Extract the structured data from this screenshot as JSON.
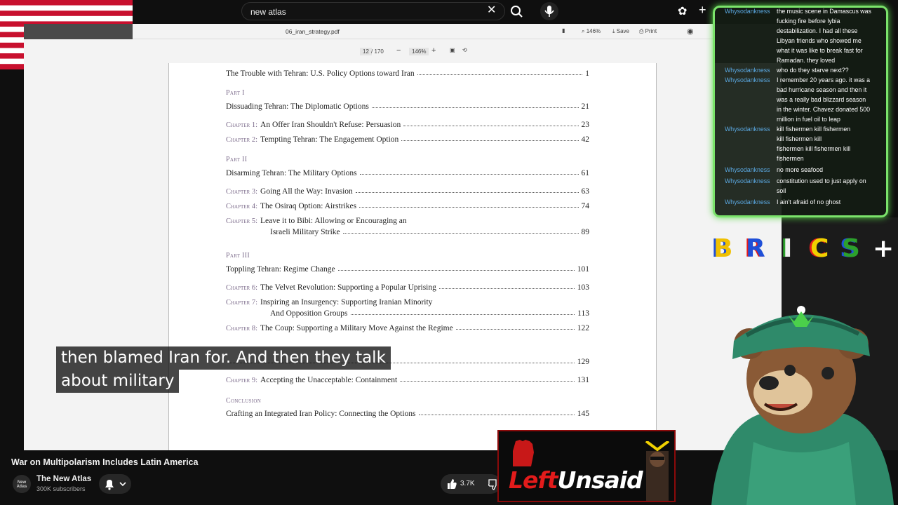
{
  "search": {
    "value": "new atlas"
  },
  "pdf": {
    "filename": "06_iran_strategy.pdf",
    "page_current": "12",
    "page_total": "/ 170",
    "zoom": "146%",
    "zoom_right": "146%",
    "save_label": "Save",
    "print_label": "Print"
  },
  "toc": {
    "intro": {
      "title": "The Trouble with Tehran: U.S. Policy Options toward Iran",
      "page": "1"
    },
    "part1": {
      "label": "Part I",
      "title": "Dissuading Tehran: The Diplomatic Options",
      "page": "21"
    },
    "ch1": {
      "chap": "Chapter 1:",
      "title": "An Offer Iran Shouldn't Refuse: Persuasion",
      "page": "23"
    },
    "ch2": {
      "chap": "Chapter 2:",
      "title": "Tempting Tehran: The Engagement Option",
      "page": "42"
    },
    "part2": {
      "label": "Part II",
      "title": "Disarming Tehran: The Military Options",
      "page": "61"
    },
    "ch3": {
      "chap": "Chapter 3:",
      "title": "Going All the Way: Invasion",
      "page": "63"
    },
    "ch4": {
      "chap": "Chapter 4:",
      "title": "The Osiraq Option: Airstrikes",
      "page": "74"
    },
    "ch5": {
      "chap": "Chapter 5:",
      "title": "Leave it to Bibi: Allowing or Encouraging an",
      "title2": "Israeli Military Strike",
      "page": "89"
    },
    "part3": {
      "label": "Part III",
      "title": "Toppling Tehran: Regime Change",
      "page": "101"
    },
    "ch6": {
      "chap": "Chapter 6:",
      "title": "The Velvet Revolution: Supporting a Popular Uprising",
      "page": "103"
    },
    "ch7": {
      "chap": "Chapter 7:",
      "title": "Inspiring an Insurgency: Supporting Iranian Minority",
      "title2": "And Opposition Groups",
      "page": "113"
    },
    "ch8": {
      "chap": "Chapter 8:",
      "title": "The Coup: Supporting a Military Move Against the Regime",
      "page": "122"
    },
    "part4": {
      "page": "129"
    },
    "ch9": {
      "chap": "Chapter 9:",
      "title": "Accepting the Unacceptable: Containment",
      "page": "131"
    },
    "conclusion": {
      "label": "Conclusion",
      "title": "Crafting an Integrated Iran Policy: Connecting the Options",
      "page": "145"
    }
  },
  "subtitle": {
    "line1": "then blamed Iran for. And then they talk",
    "line2": "about military"
  },
  "video": {
    "title": "War on Multipolarism Includes Latin America",
    "channel": "The New Atlas",
    "avatar_text": "New Atlas",
    "subscribers": "300K subscribers",
    "likes": "3.7K"
  },
  "banner": {
    "left": "Left",
    "right": "Unsaid"
  },
  "chat": [
    {
      "user": "Whysodankness",
      "text": "the music scene in Damascus was"
    },
    {
      "user": "",
      "text": "fucking fire before lybia"
    },
    {
      "user": "",
      "text": "destabilization. I had all these"
    },
    {
      "user": "",
      "text": "Libyan friends who showed me"
    },
    {
      "user": "",
      "text": "what it was like to break fast for"
    },
    {
      "user": "",
      "text": "Ramadan. they loved"
    },
    {
      "user": "Whysodankness",
      "text": "who do they starve next??"
    },
    {
      "user": "Whysodankness",
      "text": "I remember 20 years ago. it was a"
    },
    {
      "user": "",
      "text": "bad hurricane season and then it"
    },
    {
      "user": "",
      "text": "was a really bad blizzard season"
    },
    {
      "user": "",
      "text": "in the winter. Chavez donated 500"
    },
    {
      "user": "",
      "text": "million in fuel oil to leap"
    },
    {
      "user": "Whysodankness",
      "text": "kill fishermen  kill fishermen"
    },
    {
      "user": "",
      "text": "kill fishermen  kill"
    },
    {
      "user": "",
      "text": "fishermen  kill fishermen  kill"
    },
    {
      "user": "",
      "text": "fishermen"
    },
    {
      "user": "Whysodankness",
      "text": "no more seafood"
    },
    {
      "user": "Whysodankness",
      "text": "constitution used to just apply on"
    },
    {
      "user": "",
      "text": "soil"
    },
    {
      "user": "Whysodankness",
      "text": "I ain't afraid of no ghost"
    }
  ],
  "brisc": [
    "B",
    "R",
    "I",
    "C",
    "S",
    "+"
  ],
  "colors": {
    "chat_border": "#7be36b",
    "chat_user": "#5aa7e0",
    "banner_red": "#e31b1b"
  }
}
